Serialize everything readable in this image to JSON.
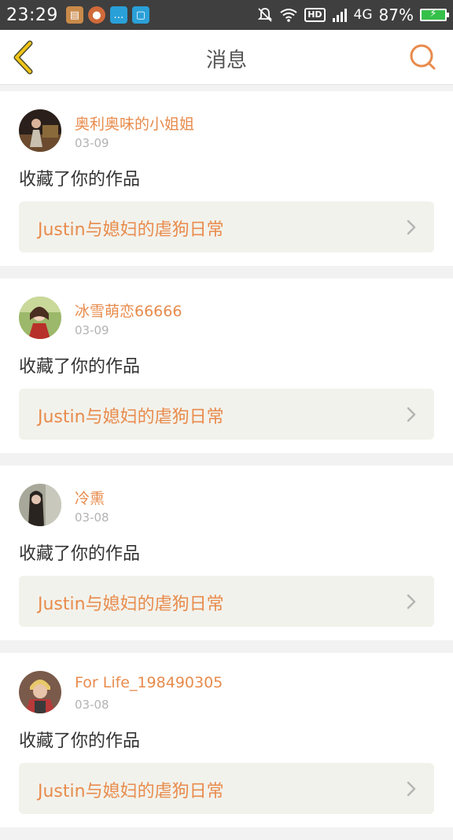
{
  "status_bar": {
    "time": "23:29",
    "network": "4G",
    "hd": "HD",
    "battery": "87%"
  },
  "header": {
    "title": "消息"
  },
  "messages": [
    {
      "username": "奥利奥味的小姐姐",
      "date": "03-09",
      "action": "收藏了你的作品",
      "work_title": "Justin与媳妇的虐狗日常"
    },
    {
      "username": "冰雪萌恋66666",
      "date": "03-09",
      "action": "收藏了你的作品",
      "work_title": "Justin与媳妇的虐狗日常"
    },
    {
      "username": "冷熏",
      "date": "03-08",
      "action": "收藏了你的作品",
      "work_title": "Justin与媳妇的虐狗日常"
    },
    {
      "username": "For Life_198490305",
      "date": "03-08",
      "action": "收藏了你的作品",
      "work_title": "Justin与媳妇的虐狗日常"
    }
  ],
  "colors": {
    "accent": "#e88b4c",
    "back_icon": "#f0c419",
    "status_bar_bg": "#3f3f3f"
  },
  "icons": {
    "back": "chevron-left-icon",
    "search": "search-icon",
    "item_arrow": "chevron-right-icon"
  }
}
